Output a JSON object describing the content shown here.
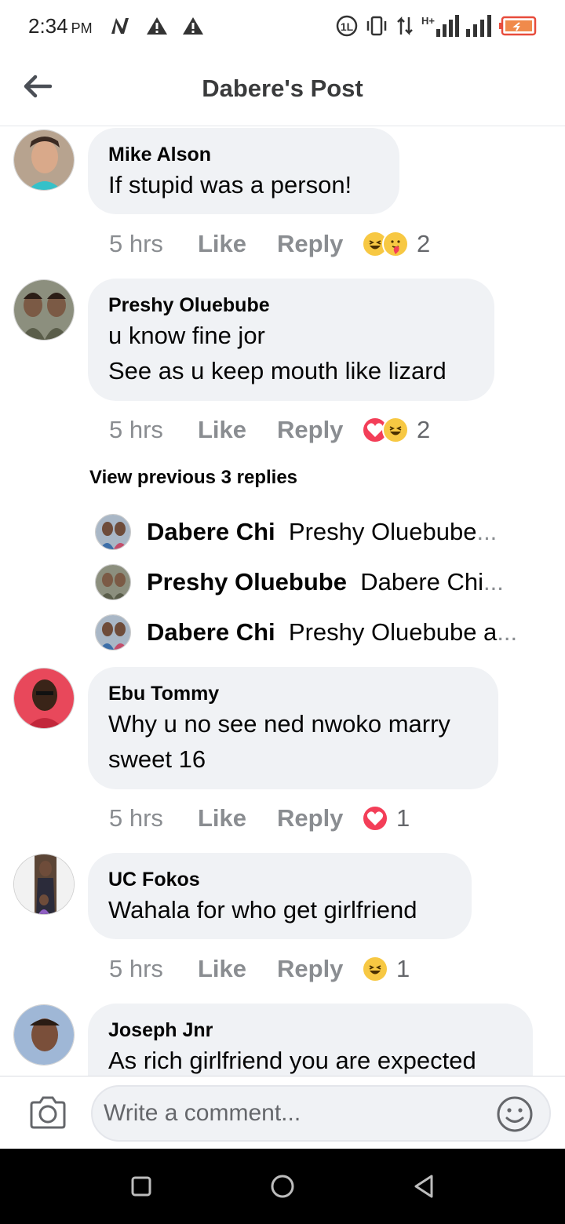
{
  "status_bar": {
    "time": "2:34",
    "ampm": "PM",
    "network": "H+"
  },
  "header": {
    "title": "Dabere's Post"
  },
  "comments": [
    {
      "author": "Mike Alson",
      "lines": [
        "If stupid was a person!"
      ],
      "time": "5 hrs",
      "like": "Like",
      "reply": "Reply",
      "reactions": [
        "haha",
        "care"
      ],
      "reaction_count": "2"
    },
    {
      "author": "Preshy Oluebube",
      "lines": [
        "u know fine jor",
        "See as u keep mouth like lizard"
      ],
      "time": "5 hrs",
      "like": "Like",
      "reply": "Reply",
      "reactions": [
        "love",
        "haha"
      ],
      "reaction_count": "2"
    },
    {
      "author": "Ebu Tommy",
      "lines": [
        "Why u no see ned nwoko marry",
        "sweet 16"
      ],
      "time": "5 hrs",
      "like": "Like",
      "reply": "Reply",
      "reactions": [
        "love"
      ],
      "reaction_count": "1"
    },
    {
      "author": "UC Fokos",
      "lines": [
        "Wahala for who get girlfriend"
      ],
      "time": "5 hrs",
      "like": "Like",
      "reply": "Reply",
      "reactions": [
        "haha"
      ],
      "reaction_count": "1"
    },
    {
      "author": "Joseph Jnr",
      "lines": [
        "As rich girlfriend you are expected"
      ]
    }
  ],
  "replies_section": {
    "view_previous": "View previous 3 replies",
    "replies": [
      {
        "name": "Dabere Chi",
        "text": "Preshy Oluebube",
        "ellipsis": "..."
      },
      {
        "name": "Preshy Oluebube",
        "text": "Dabere Chi",
        "ellipsis": "..."
      },
      {
        "name": "Dabere Chi",
        "text": "Preshy Oluebube a",
        "ellipsis": "..."
      }
    ]
  },
  "composer": {
    "placeholder": "Write a comment..."
  },
  "colors": {
    "bubble": "#f0f2f5",
    "muted_text": "#8a8d91",
    "haha": "#f7c843",
    "love": "#f33e58"
  }
}
